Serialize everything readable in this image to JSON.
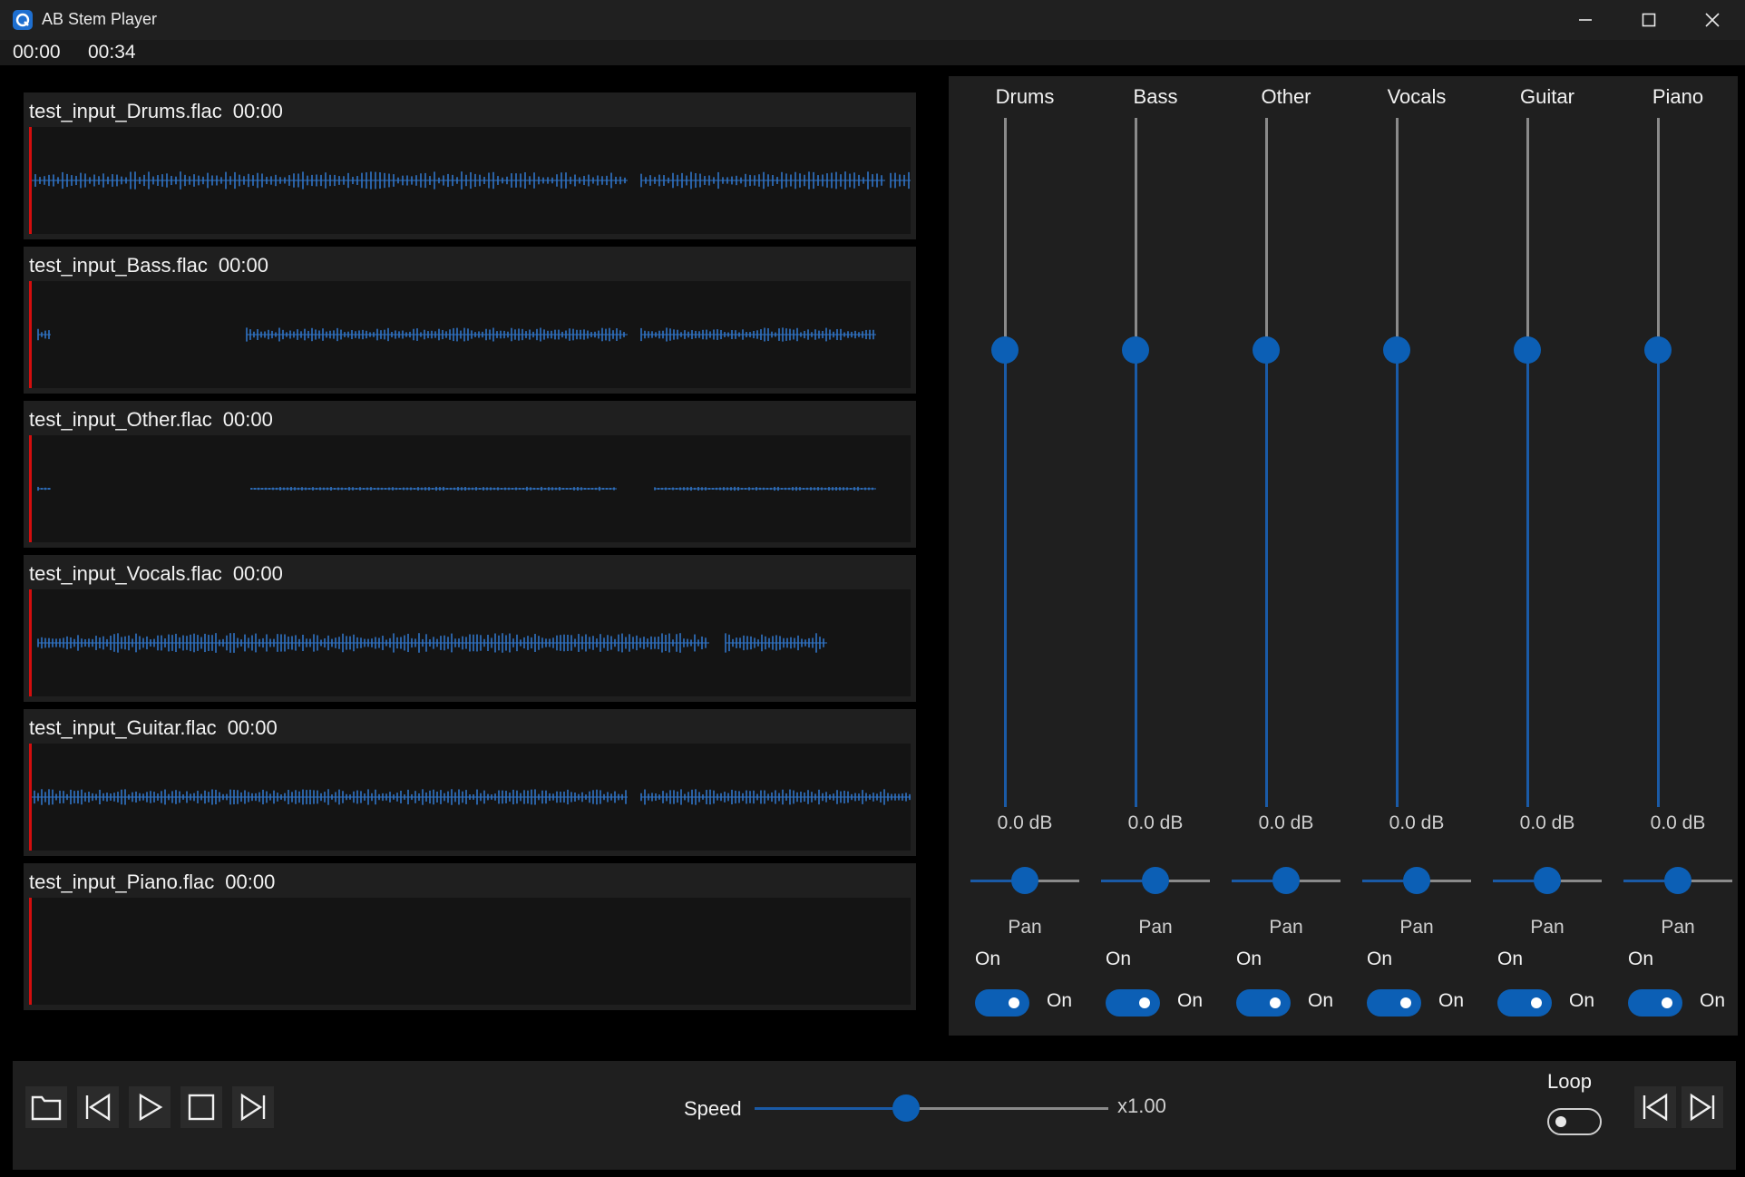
{
  "window": {
    "title": "AB Stem Player"
  },
  "timebar": {
    "current": "00:00",
    "total": "00:34"
  },
  "tracks": [
    {
      "file": "test_input_Drums.flac",
      "time": "00:00"
    },
    {
      "file": "test_input_Bass.flac",
      "time": "00:00"
    },
    {
      "file": "test_input_Other.flac",
      "time": "00:00"
    },
    {
      "file": "test_input_Vocals.flac",
      "time": "00:00"
    },
    {
      "file": "test_input_Guitar.flac",
      "time": "00:00"
    },
    {
      "file": "test_input_Piano.flac",
      "time": "00:00"
    }
  ],
  "mixer": {
    "pan_label": "Pan",
    "channels": [
      {
        "name": "Drums",
        "gain": "0.0 dB",
        "state": "On",
        "toggle_label": "On"
      },
      {
        "name": "Bass",
        "gain": "0.0 dB",
        "state": "On",
        "toggle_label": "On"
      },
      {
        "name": "Other",
        "gain": "0.0 dB",
        "state": "On",
        "toggle_label": "On"
      },
      {
        "name": "Vocals",
        "gain": "0.0 dB",
        "state": "On",
        "toggle_label": "On"
      },
      {
        "name": "Guitar",
        "gain": "0.0 dB",
        "state": "On",
        "toggle_label": "On"
      },
      {
        "name": "Piano",
        "gain": "0.0 dB",
        "state": "On",
        "toggle_label": "On"
      }
    ]
  },
  "transport": {
    "speed_label": "Speed",
    "speed_value": "x1.00",
    "loop_label": "Loop"
  },
  "colors": {
    "accent": "#0c5fb5",
    "waveform": "#2f73c6",
    "playhead": "#d40d0d",
    "panel": "#1f1f1f"
  }
}
